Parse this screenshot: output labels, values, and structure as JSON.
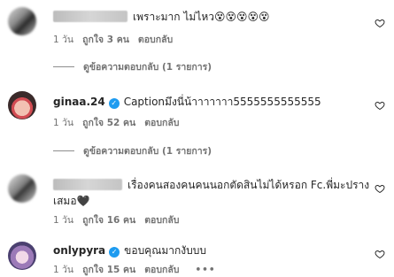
{
  "comments": [
    {
      "username": "",
      "text": "เพราะมาก ไม่ไหว😵😵😵😵😵",
      "time": "1 วัน",
      "likes": "ถูกใจ 3 คน",
      "reply": "ตอบกลับ",
      "view_replies": "ดูข้อความตอบกลับ (1 รายการ)"
    },
    {
      "username": "ginaa.24",
      "text": "Captionมึงนี่น้าาาาาาา5555555555555",
      "time": "1 วัน",
      "likes": "ถูกใจ 52 คน",
      "reply": "ตอบกลับ",
      "view_replies": "ดูข้อความตอบกลับ (1 รายการ)"
    },
    {
      "username": "",
      "text_line1": "เรื่องคนสองคนคนนอกตัดสินไม่ได้หรอก Fc.พี่มะปราง",
      "text_line2": "เสมอ🖤",
      "time": "1 วัน",
      "likes": "ถูกใจ 16 คน",
      "reply": "ตอบกลับ"
    },
    {
      "username": "onlypyra",
      "text": "ขอบคุณมากงับบบ",
      "time": "1 วัน",
      "likes": "ถูกใจ 15 คน",
      "reply": "ตอบกลับ",
      "more": "•••"
    }
  ]
}
